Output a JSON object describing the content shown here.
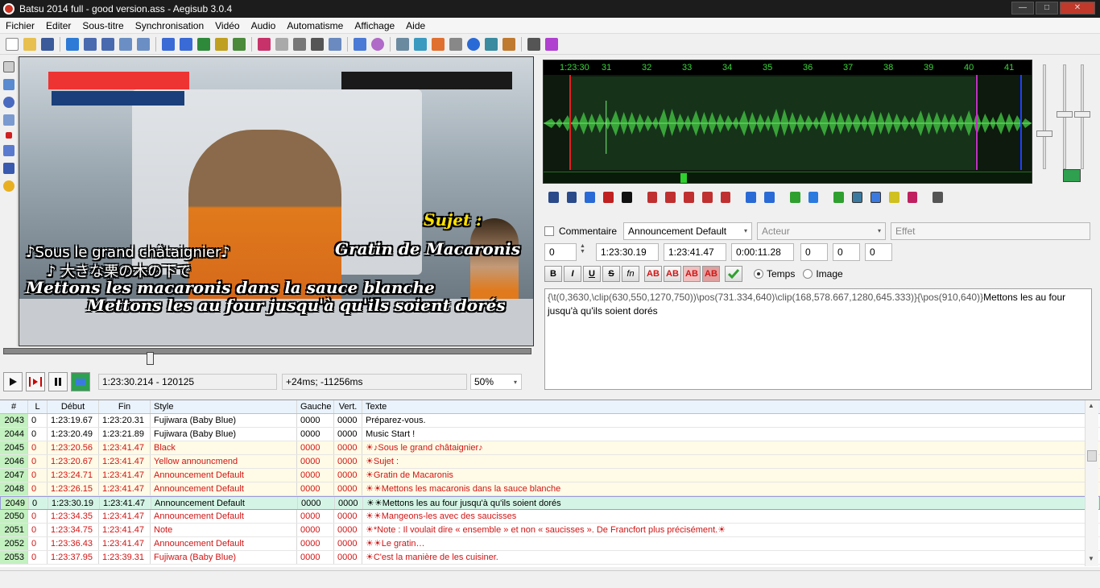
{
  "window": {
    "title": "Batsu 2014 full - good version.ass - Aegisub 3.0.4",
    "minimize": "—",
    "maximize": "□",
    "close": "✕"
  },
  "menu": [
    "Fichier",
    "Editer",
    "Sous-titre",
    "Synchronisation",
    "Vidéo",
    "Audio",
    "Automatisme",
    "Affichage",
    "Aide"
  ],
  "video": {
    "subs": {
      "line1": "♪Sous le grand châtaignier♪",
      "line2": "♪ 大きな栗の木の下で",
      "line3": "Mettons les macaronis dans la sauce blanche",
      "line4": "Mettons les au four jusqu'à qu'ils soient dorés",
      "sujet": "Sujet :",
      "gratin": "Gratin de Macaronis"
    },
    "time": "1:23:30.214 - 120125",
    "offset": "+24ms; -11256ms",
    "zoom": "50%"
  },
  "audio": {
    "ruler": [
      "1:23:30",
      "31",
      "32",
      "33",
      "34",
      "35",
      "36",
      "37",
      "38",
      "39",
      "40",
      "41"
    ]
  },
  "edit": {
    "comment_label": "Commentaire",
    "style": "Announcement Default",
    "actor_placeholder": "Acteur",
    "effect_placeholder": "Effet",
    "layer": "0",
    "start": "1:23:30.19",
    "end": "1:23:41.47",
    "duration": "0:00:11.28",
    "margin_l": "0",
    "margin_r": "0",
    "margin_v": "0",
    "format_buttons": [
      "B",
      "I",
      "U",
      "S",
      "fn",
      "AB",
      "AB",
      "AB",
      "AB"
    ],
    "radio_time": "Temps",
    "radio_frame": "Image",
    "text_tags": "{\\t(0,3630,\\clip(630,550,1270,750))\\pos(731.334,640)\\clip(168,578.667,1280,645.333)}{\\pos(910,640)}",
    "text_body": "Mettons les au four jusqu'à qu'ils soient dorés"
  },
  "grid": {
    "headers": [
      "#",
      "L",
      "Début",
      "Fin",
      "Style",
      "Gauche",
      "Vert.",
      "Texte"
    ],
    "rows": [
      {
        "n": "2043",
        "l": "0",
        "start": "1:23:19.67",
        "end": "1:23:20.31",
        "style": "Fujiwara (Baby Blue)",
        "ml": "0000",
        "mv": "0000",
        "text": "Préparez-vous.",
        "kind": "normal"
      },
      {
        "n": "2044",
        "l": "0",
        "start": "1:23:20.49",
        "end": "1:23:21.89",
        "style": "Fujiwara (Baby Blue)",
        "ml": "0000",
        "mv": "0000",
        "text": "Music Start !",
        "kind": "normal"
      },
      {
        "n": "2045",
        "l": "0",
        "start": "1:23:20.56",
        "end": "1:23:41.47",
        "style": "Black",
        "ml": "0000",
        "mv": "0000",
        "text": "☀♪Sous le grand châtaignier♪",
        "kind": "red alt"
      },
      {
        "n": "2046",
        "l": "0",
        "start": "1:23:20.67",
        "end": "1:23:41.47",
        "style": "Yellow announcmend",
        "ml": "0000",
        "mv": "0000",
        "text": "☀Sujet :",
        "kind": "red alt"
      },
      {
        "n": "2047",
        "l": "0",
        "start": "1:23:24.71",
        "end": "1:23:41.47",
        "style": "Announcement Default",
        "ml": "0000",
        "mv": "0000",
        "text": "☀Gratin de Macaronis",
        "kind": "red alt"
      },
      {
        "n": "2048",
        "l": "0",
        "start": "1:23:26.15",
        "end": "1:23:41.47",
        "style": "Announcement Default",
        "ml": "0000",
        "mv": "0000",
        "text": "☀☀Mettons les macaronis dans la sauce blanche",
        "kind": "red alt"
      },
      {
        "n": "2049",
        "l": "0",
        "start": "1:23:30.19",
        "end": "1:23:41.47",
        "style": "Announcement Default",
        "ml": "0000",
        "mv": "0000",
        "text": "☀☀Mettons les au four jusqu'à qu'ils soient dorés",
        "kind": "sel"
      },
      {
        "n": "2050",
        "l": "0",
        "start": "1:23:34.35",
        "end": "1:23:41.47",
        "style": "Announcement Default",
        "ml": "0000",
        "mv": "0000",
        "text": "☀☀Mangeons-les avec des saucisses",
        "kind": "red"
      },
      {
        "n": "2051",
        "l": "0",
        "start": "1:23:34.75",
        "end": "1:23:41.47",
        "style": "Note",
        "ml": "0000",
        "mv": "0000",
        "text": "☀*Note : Il voulait dire « ensemble » et non « saucisses ». De Francfort plus précisément.☀",
        "kind": "red"
      },
      {
        "n": "2052",
        "l": "0",
        "start": "1:23:36.43",
        "end": "1:23:41.47",
        "style": "Announcement Default",
        "ml": "0000",
        "mv": "0000",
        "text": "☀☀Le gratin…",
        "kind": "red"
      },
      {
        "n": "2053",
        "l": "0",
        "start": "1:23:37.95",
        "end": "1:23:39.31",
        "style": "Fujiwara (Baby Blue)",
        "ml": "0000",
        "mv": "0000",
        "text": "☀C'est la manière de les cuisiner.",
        "kind": "red"
      }
    ]
  }
}
